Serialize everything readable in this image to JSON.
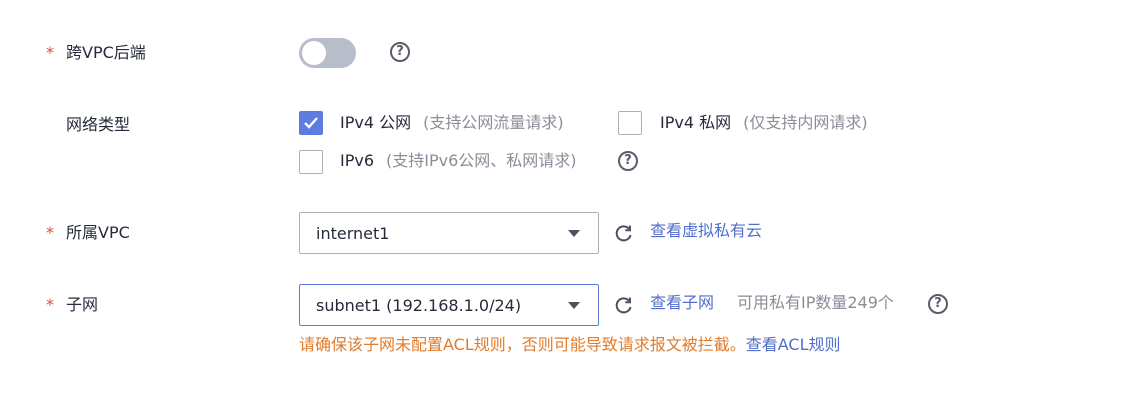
{
  "required_mark": "*",
  "cross_vpc": {
    "label": "跨VPC后端",
    "toggle_on": false,
    "help_icon": "question-circle-icon"
  },
  "network_type": {
    "label": "网络类型",
    "options": [
      {
        "label": "IPv4 公网",
        "note": "(支持公网流量请求)",
        "checked": true
      },
      {
        "label": "IPv4 私网",
        "note": "(仅支持内网请求)",
        "checked": false
      },
      {
        "label": "IPv6",
        "note": "(支持IPv6公网、私网请求)",
        "checked": false
      }
    ],
    "help_icon": "question-circle-icon"
  },
  "vpc": {
    "label": "所属VPC",
    "selected": "internet1",
    "refresh_icon": "refresh-icon",
    "link": "查看虚拟私有云"
  },
  "subnet": {
    "label": "子网",
    "selected": "subnet1 (192.168.1.0/24)",
    "refresh_icon": "refresh-icon",
    "link": "查看子网",
    "available": "可用私有IP数量249个",
    "help_icon": "question-circle-icon",
    "warning": "请确保该子网未配置ACL规则，否则可能导致请求报文被拦截。",
    "warning_link": "查看ACL规则"
  },
  "colors": {
    "accent": "#5e7ce0",
    "link": "#526ecc",
    "required": "#e54545",
    "warning": "#e07c2c",
    "muted": "#8a8e99"
  }
}
